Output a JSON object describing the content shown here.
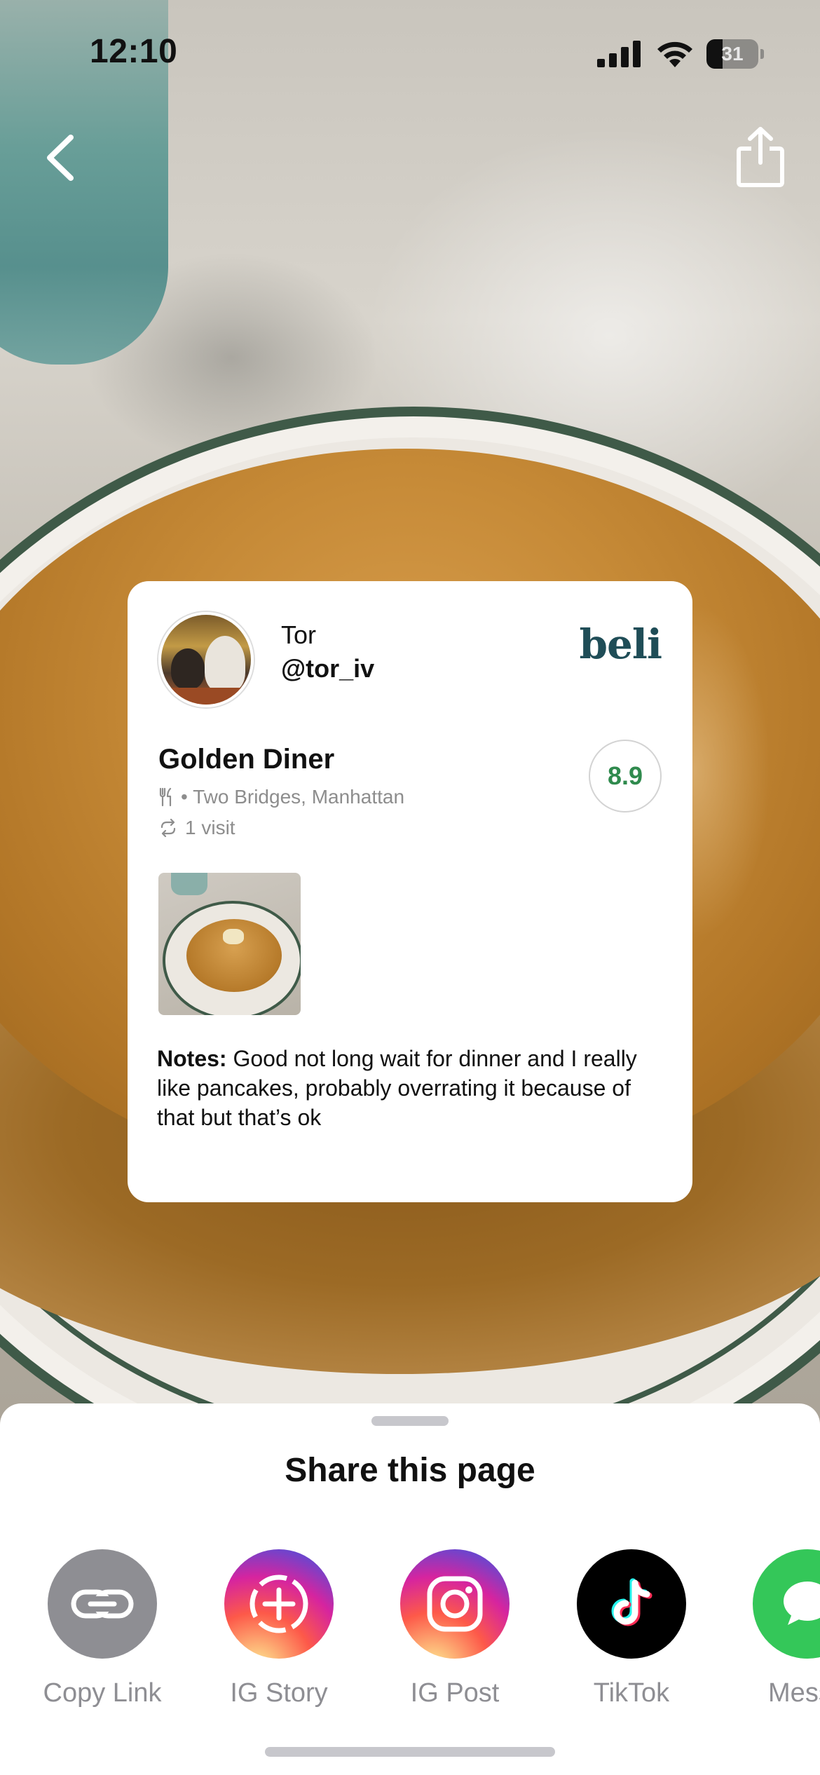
{
  "status_bar": {
    "time": "12:10",
    "battery_level": "31",
    "battery_fraction": 0.31,
    "icons": [
      "signal-icon",
      "wifi-icon",
      "battery-icon"
    ]
  },
  "nav": {
    "back_icon": "chevron-left-icon",
    "share_icon": "share-icon"
  },
  "card": {
    "user": {
      "name": "Tor",
      "handle": "@tor_iv"
    },
    "brand": "beli",
    "restaurant": {
      "name": "Golden Diner",
      "location": "• Two Bridges, Manhattan",
      "visits": "1 visit",
      "score": "8.9"
    },
    "notes_label": "Notes:",
    "notes_text": " Good not long wait for dinner and I really like pancakes, probably overrating it because of that but that’s ok"
  },
  "sheet": {
    "title": "Share this page",
    "options": [
      {
        "label": "Copy Link",
        "icon": "link-icon"
      },
      {
        "label": "IG Story",
        "icon": "ig-story-icon"
      },
      {
        "label": "IG Post",
        "icon": "instagram-icon"
      },
      {
        "label": "TikTok",
        "icon": "tiktok-icon"
      },
      {
        "label": "Messa",
        "icon": "message-icon"
      }
    ]
  },
  "colors": {
    "score": "#2f8a4d",
    "brand": "#1f4d57",
    "copy_link": "#8e8e93",
    "message": "#34c759"
  }
}
